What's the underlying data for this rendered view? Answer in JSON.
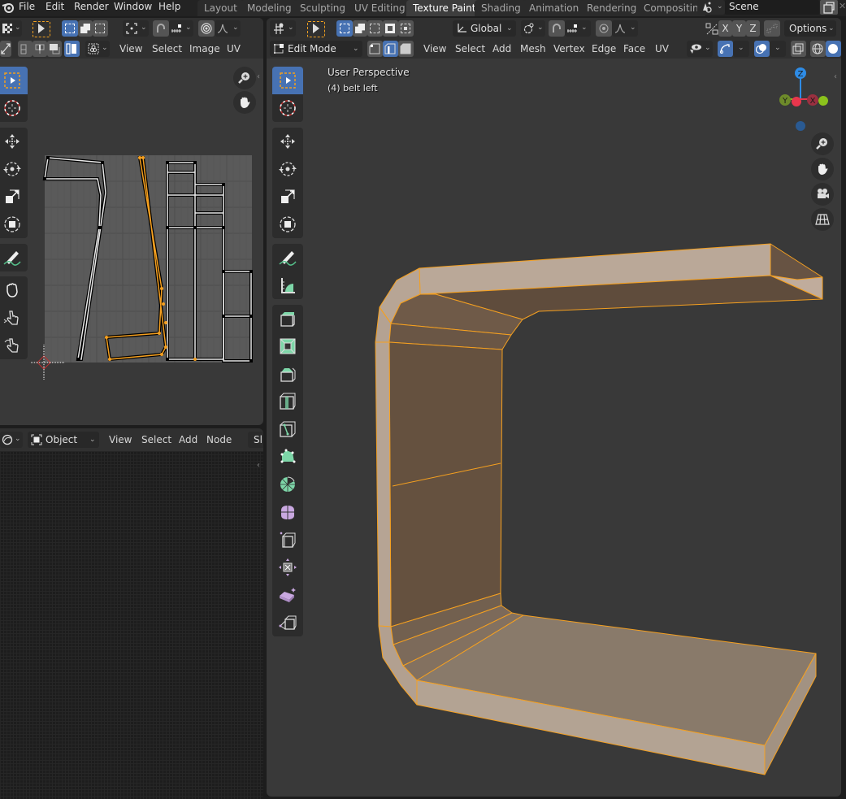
{
  "topbar": {
    "menus": [
      "File",
      "Edit",
      "Render",
      "Window",
      "Help"
    ],
    "workspaces": [
      {
        "label": "Layout",
        "active": false
      },
      {
        "label": "Modeling",
        "active": false
      },
      {
        "label": "Sculpting",
        "active": false
      },
      {
        "label": "UV Editing",
        "active": false
      },
      {
        "label": "Texture Paint",
        "active": true
      },
      {
        "label": "Shading",
        "active": false
      },
      {
        "label": "Animation",
        "active": false
      },
      {
        "label": "Rendering",
        "active": false
      },
      {
        "label": "Compositin",
        "active": false
      }
    ],
    "scene_name": "Scene"
  },
  "uv_editor": {
    "menus": [
      "View",
      "Select",
      "Image",
      "UV"
    ]
  },
  "node_editor": {
    "mode": "Object",
    "menus": [
      "View",
      "Select",
      "Add",
      "Node"
    ],
    "slot_label": "Sl"
  },
  "viewport": {
    "transform_orientation": "Global",
    "options_label": "Options",
    "axis_buttons": [
      "X",
      "Y",
      "Z"
    ],
    "mode": "Edit Mode",
    "menus": [
      "View",
      "Select",
      "Add",
      "Mesh",
      "Vertex",
      "Edge",
      "Face",
      "UV"
    ],
    "perspective_label": "User Perspective",
    "object_label": "(4) belt left",
    "gizmo_axes": {
      "z": "Z",
      "y": "Y",
      "x": "X"
    },
    "colors": {
      "select_orange": "#f5a020",
      "active_blue": "#4772b3",
      "axis_x": "#e8364d",
      "axis_y": "#8bc21c",
      "axis_z": "#2e8ce6"
    }
  }
}
